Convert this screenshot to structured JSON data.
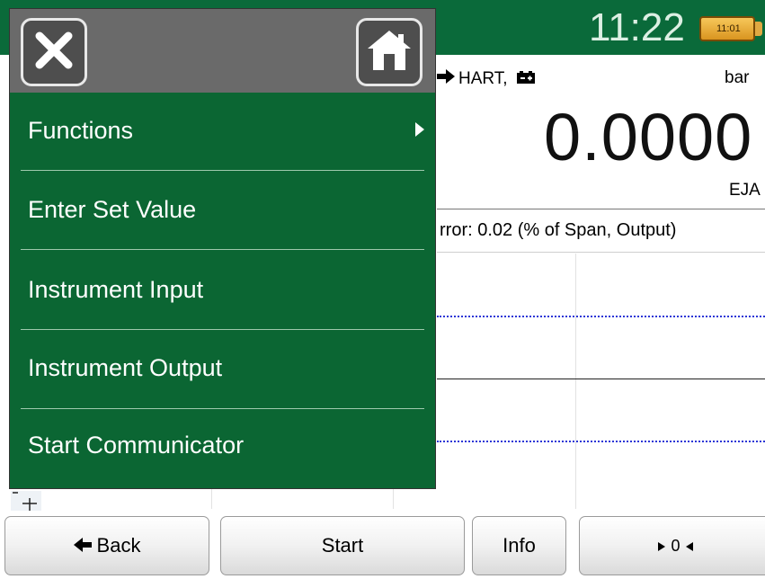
{
  "status": {
    "time": "11:22",
    "battery_label": "11:01"
  },
  "reading": {
    "source": "HART,",
    "unit": "bar",
    "value": "0.0000",
    "device": "EJA",
    "error_text": "rror: 0.02 (% of Span, Output)"
  },
  "menu": {
    "close_icon": "close-icon",
    "home_icon": "home-icon",
    "items": [
      {
        "label": "Functions",
        "has_submenu": true
      },
      {
        "label": "Enter Set Value",
        "has_submenu": false
      },
      {
        "label": "Instrument Input",
        "has_submenu": false
      },
      {
        "label": "Instrument Output",
        "has_submenu": false
      },
      {
        "label": "Start Communicator",
        "has_submenu": false
      }
    ]
  },
  "buttons": {
    "back": "Back",
    "start": "Start",
    "info": "Info",
    "zero": "0"
  },
  "colors": {
    "header_green": "#0a6a3a",
    "menu_green": "#0b6633",
    "menu_header_gray": "#6a6a6a",
    "trace_blue": "#2b36d6"
  }
}
